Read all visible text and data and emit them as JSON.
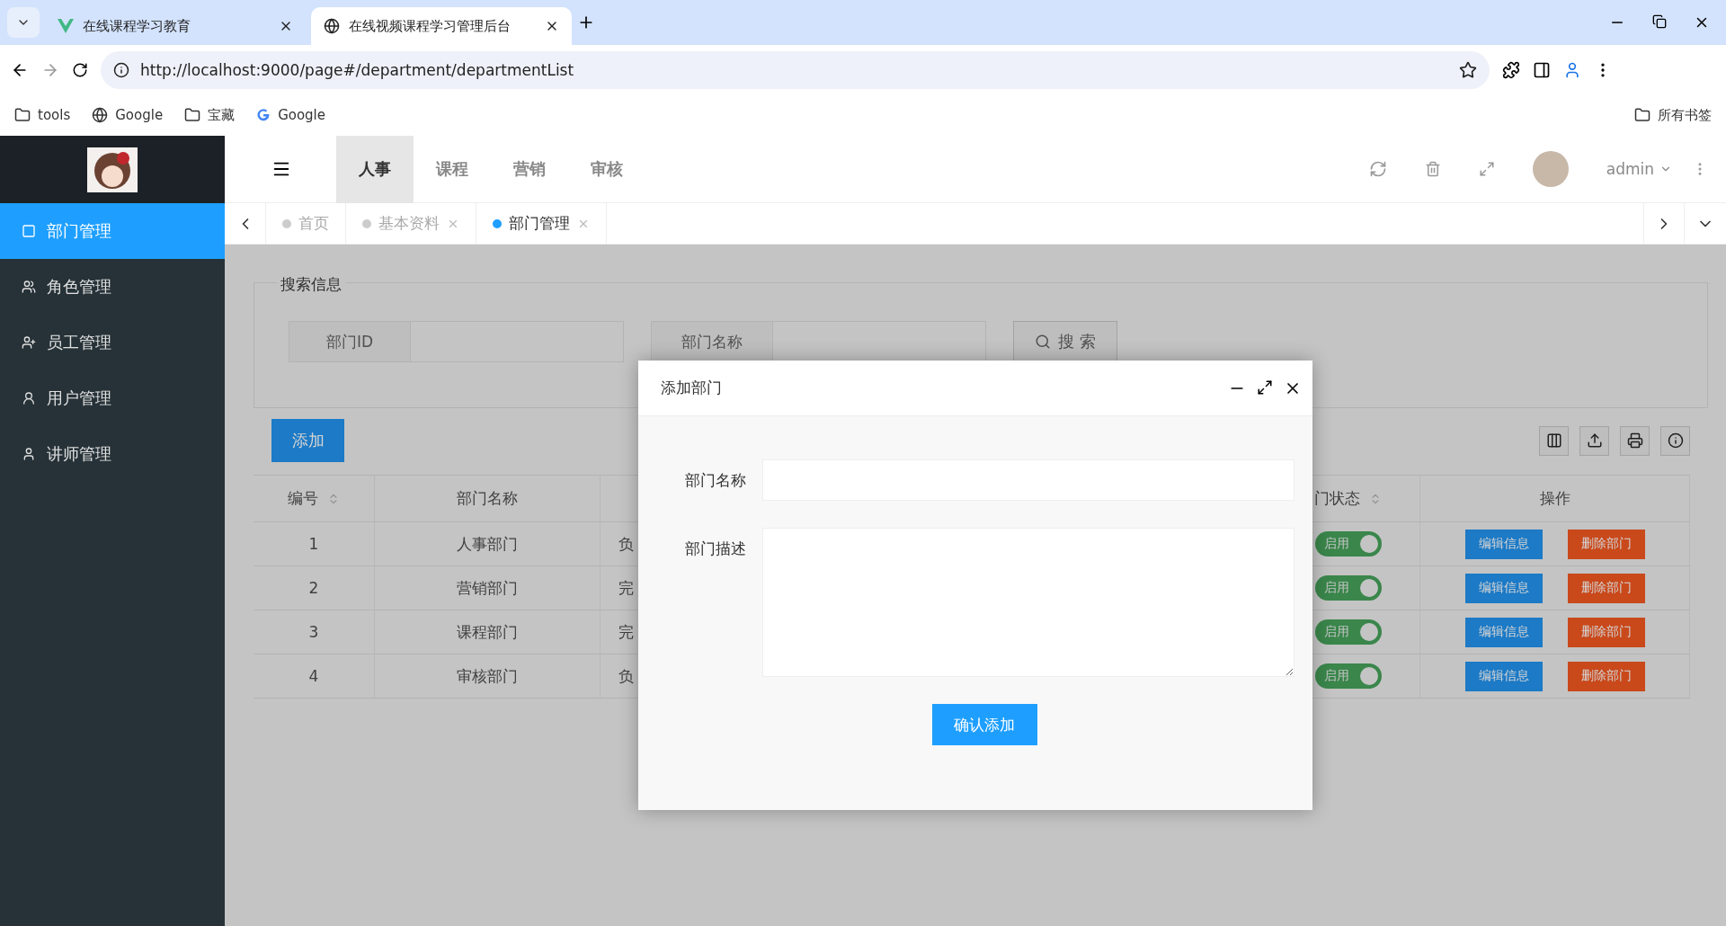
{
  "browser": {
    "tabs": [
      {
        "title": "在线课程学习教育",
        "kind": "vue",
        "selected": false
      },
      {
        "title": "在线视频课程学习管理后台",
        "kind": "globe",
        "selected": true
      }
    ],
    "url": "http://localhost:9000/page#/department/departmentList",
    "bookmarks": [
      {
        "label": "tools",
        "kind": "folder"
      },
      {
        "label": "Google",
        "kind": "globe"
      },
      {
        "label": "宝藏",
        "kind": "folder"
      },
      {
        "label": "Google",
        "kind": "g"
      }
    ],
    "all_bookmarks": "所有书签"
  },
  "sidebar": {
    "items": [
      {
        "label": "部门管理",
        "selected": true
      },
      {
        "label": "角色管理",
        "selected": false
      },
      {
        "label": "员工管理",
        "selected": false
      },
      {
        "label": "用户管理",
        "selected": false
      },
      {
        "label": "讲师管理",
        "selected": false
      }
    ]
  },
  "header": {
    "nav": [
      {
        "label": "人事",
        "selected": true
      },
      {
        "label": "课程",
        "selected": false
      },
      {
        "label": "营销",
        "selected": false
      },
      {
        "label": "审核",
        "selected": false
      }
    ],
    "user": "admin"
  },
  "page_tabs": [
    {
      "label": "首页",
      "selected": false,
      "closable": false
    },
    {
      "label": "基本资料",
      "selected": false,
      "closable": true
    },
    {
      "label": "部门管理",
      "selected": true,
      "closable": true
    }
  ],
  "search": {
    "title": "搜索信息",
    "fields": [
      {
        "label": "部门ID"
      },
      {
        "label": "部门名称"
      }
    ],
    "button": "搜 索"
  },
  "add_button": "添加",
  "table": {
    "columns": [
      "编号",
      "部门名称",
      "",
      "门状态",
      "操作"
    ],
    "rows": [
      {
        "id": "1",
        "name": "人事部门",
        "column_3": "负",
        "on": true,
        "status": "启用",
        "actions": [
          "编辑信息",
          "删除部门"
        ]
      },
      {
        "id": "2",
        "name": "营销部门",
        "column_3": "完",
        "on": true,
        "status": "启用",
        "actions": [
          "编辑信息",
          "删除部门"
        ]
      },
      {
        "id": "3",
        "name": "课程部门",
        "column_3": "完",
        "on": true,
        "status": "启用",
        "actions": [
          "编辑信息",
          "删除部门"
        ]
      },
      {
        "id": "4",
        "name": "审核部门",
        "column_3": "负",
        "on": true,
        "status": "启用",
        "actions": [
          "编辑信息",
          "删除部门"
        ]
      }
    ]
  },
  "dialog": {
    "title": "添加部门",
    "fields": [
      {
        "label": "部门名称",
        "kind": "input"
      },
      {
        "label": "部门描述",
        "kind": "textarea"
      }
    ],
    "submit": "确认添加"
  }
}
